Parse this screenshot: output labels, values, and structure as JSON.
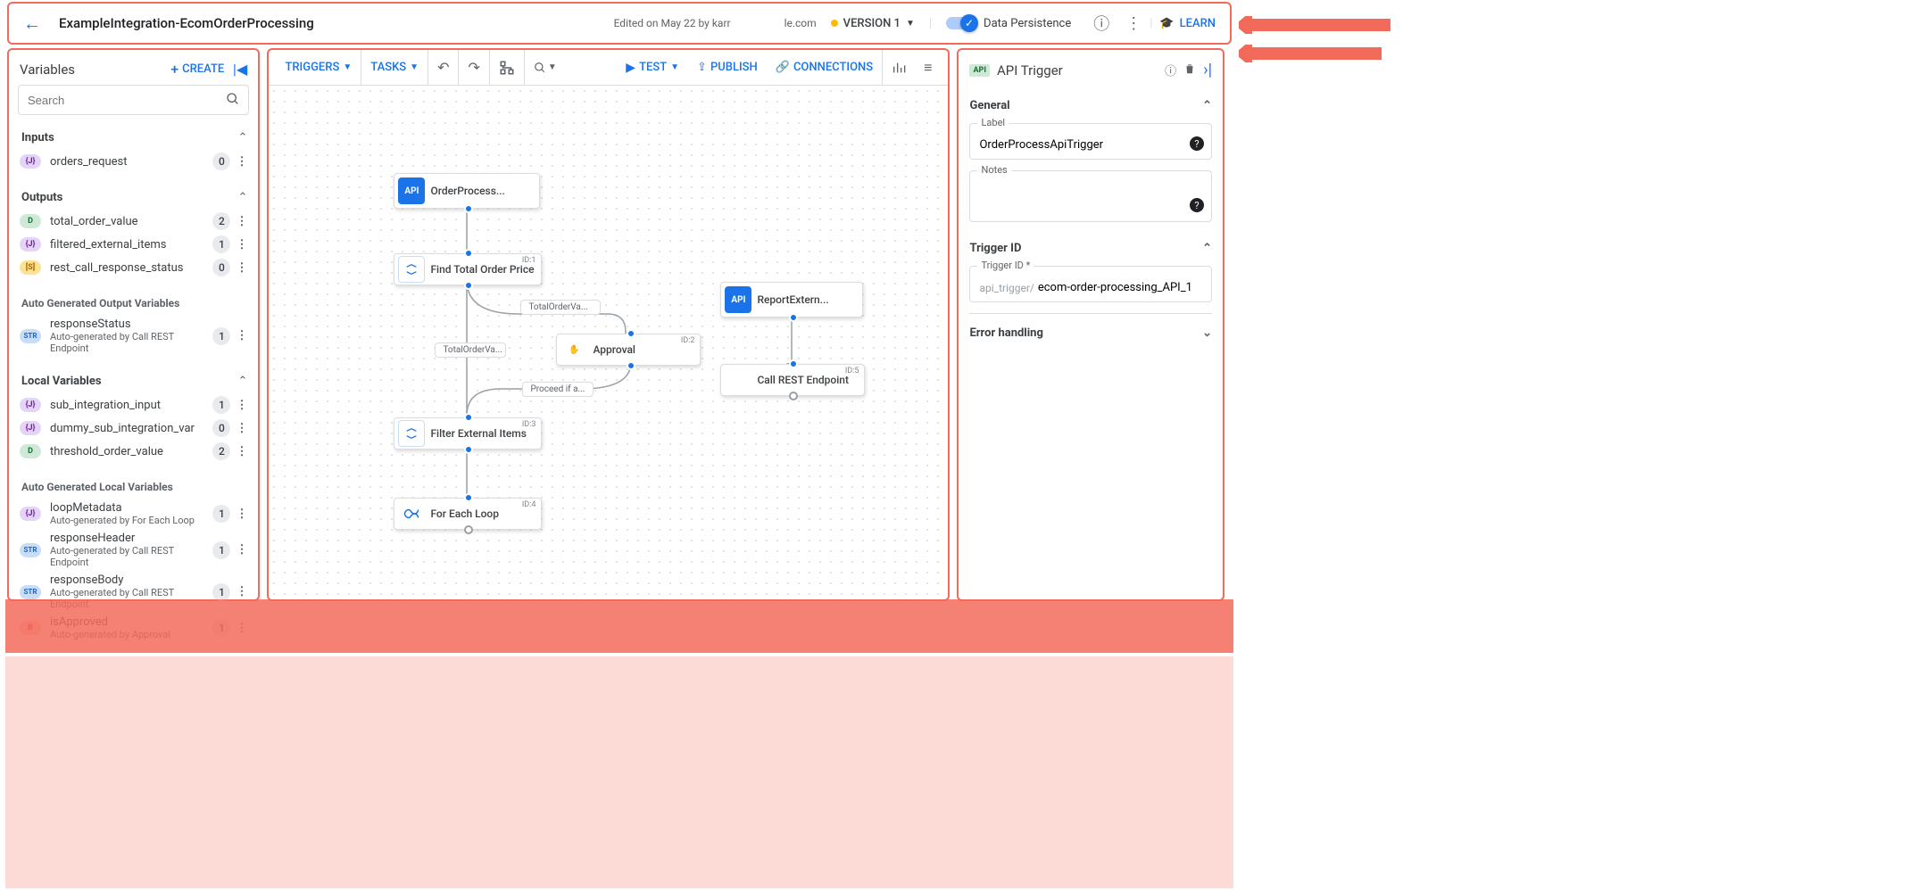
{
  "topbar": {
    "title": "ExampleIntegration-EcomOrderProcessing",
    "edited": "Edited on May 22 by karr",
    "domain": "le.com",
    "version_label": "VERSION 1",
    "data_persistence": "Data Persistence",
    "learn": "LEARN"
  },
  "left": {
    "title": "Variables",
    "create": "CREATE",
    "search_placeholder": "Search",
    "inputs_label": "Inputs",
    "outputs_label": "Outputs",
    "auto_out_label": "Auto Generated Output Variables",
    "local_label": "Local Variables",
    "auto_local_label": "Auto Generated Local Variables",
    "inputs": [
      {
        "t": "J",
        "name": "orders_request",
        "c": "0"
      }
    ],
    "outputs": [
      {
        "t": "D",
        "name": "total_order_value",
        "c": "2"
      },
      {
        "t": "J",
        "name": "filtered_external_items",
        "c": "1"
      },
      {
        "t": "S",
        "name": "rest_call_response_status",
        "c": "0"
      }
    ],
    "auto_out": [
      {
        "t": "STR",
        "name": "responseStatus",
        "sub": "Auto-generated by Call REST Endpoint",
        "c": "1"
      }
    ],
    "local": [
      {
        "t": "J",
        "name": "sub_integration_input",
        "c": "1"
      },
      {
        "t": "J",
        "name": "dummy_sub_integration_var",
        "c": "0"
      },
      {
        "t": "D",
        "name": "threshold_order_value",
        "c": "2"
      }
    ],
    "auto_local": [
      {
        "t": "J",
        "name": "loopMetadata",
        "sub": "Auto-generated by For Each Loop",
        "c": "1"
      },
      {
        "t": "STR",
        "name": "responseHeader",
        "sub": "Auto-generated by Call REST Endpoint",
        "c": "1"
      },
      {
        "t": "STR",
        "name": "responseBody",
        "sub": "Auto-generated by Call REST Endpoint",
        "c": "1"
      },
      {
        "t": "B",
        "name": "isApproved",
        "sub": "Auto-generated by Approval",
        "c": "1"
      }
    ]
  },
  "canvas_toolbar": {
    "triggers": "TRIGGERS",
    "tasks": "TASKS",
    "test": "TEST",
    "publish": "PUBLISH",
    "connections": "CONNECTIONS"
  },
  "nodes": {
    "n0": "OrderProcess...",
    "n1": "Find Total Order Price",
    "n1id": "ID:1",
    "n2": "Approval",
    "n2id": "ID:2",
    "n3": "Filter External Items",
    "n3id": "ID:3",
    "n4": "For Each Loop",
    "n4id": "ID:4",
    "n5": "ReportExtern...",
    "n6": "Call REST Endpoint",
    "n6id": "ID:5",
    "e1": "TotalOrderVa...",
    "e2": "TotalOrderVa...",
    "e3": "Proceed if a..."
  },
  "right": {
    "title": "API Trigger",
    "general": "General",
    "label_lbl": "Label",
    "label_val": "OrderProcessApiTrigger",
    "notes_lbl": "Notes",
    "triggerid_section": "Trigger ID",
    "triggerid_lbl": "Trigger ID *",
    "triggerid_prefix": "api_trigger/",
    "triggerid_val": "ecom-order-processing_API_1",
    "error_section": "Error handling"
  }
}
